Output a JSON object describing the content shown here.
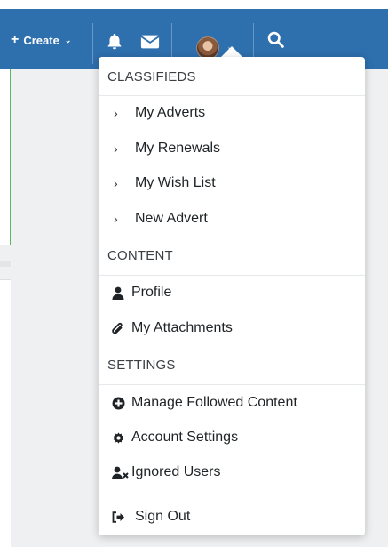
{
  "navbar": {
    "create_label": "Create",
    "create_icon": "plus-icon",
    "create_caret": "chevron-down-icon",
    "notifications_icon": "bell-icon",
    "messages_icon": "envelope-icon",
    "avatar_caret": "chevron-down-icon",
    "search_icon": "search-icon",
    "bar_color": "#2e6fae"
  },
  "dropdown": {
    "sections": [
      {
        "heading": "CLASSIFIEDS",
        "items": [
          {
            "label": "My Adverts",
            "icon": "chevron-right-icon"
          },
          {
            "label": "My Renewals",
            "icon": "chevron-right-icon"
          },
          {
            "label": "My Wish List",
            "icon": "chevron-right-icon"
          },
          {
            "label": "New Advert",
            "icon": "chevron-right-icon"
          }
        ]
      },
      {
        "heading": "CONTENT",
        "items": [
          {
            "label": "Profile",
            "icon": "user-icon"
          },
          {
            "label": "My Attachments",
            "icon": "paperclip-icon"
          }
        ]
      },
      {
        "heading": "SETTINGS",
        "items": [
          {
            "label": "Manage Followed Content",
            "icon": "plus-circle-icon"
          },
          {
            "label": "Account Settings",
            "icon": "gear-icon"
          },
          {
            "label": "Ignored Users",
            "icon": "user-times-icon"
          }
        ]
      }
    ],
    "sign_out": {
      "label": "Sign Out",
      "icon": "sign-out-icon"
    }
  }
}
